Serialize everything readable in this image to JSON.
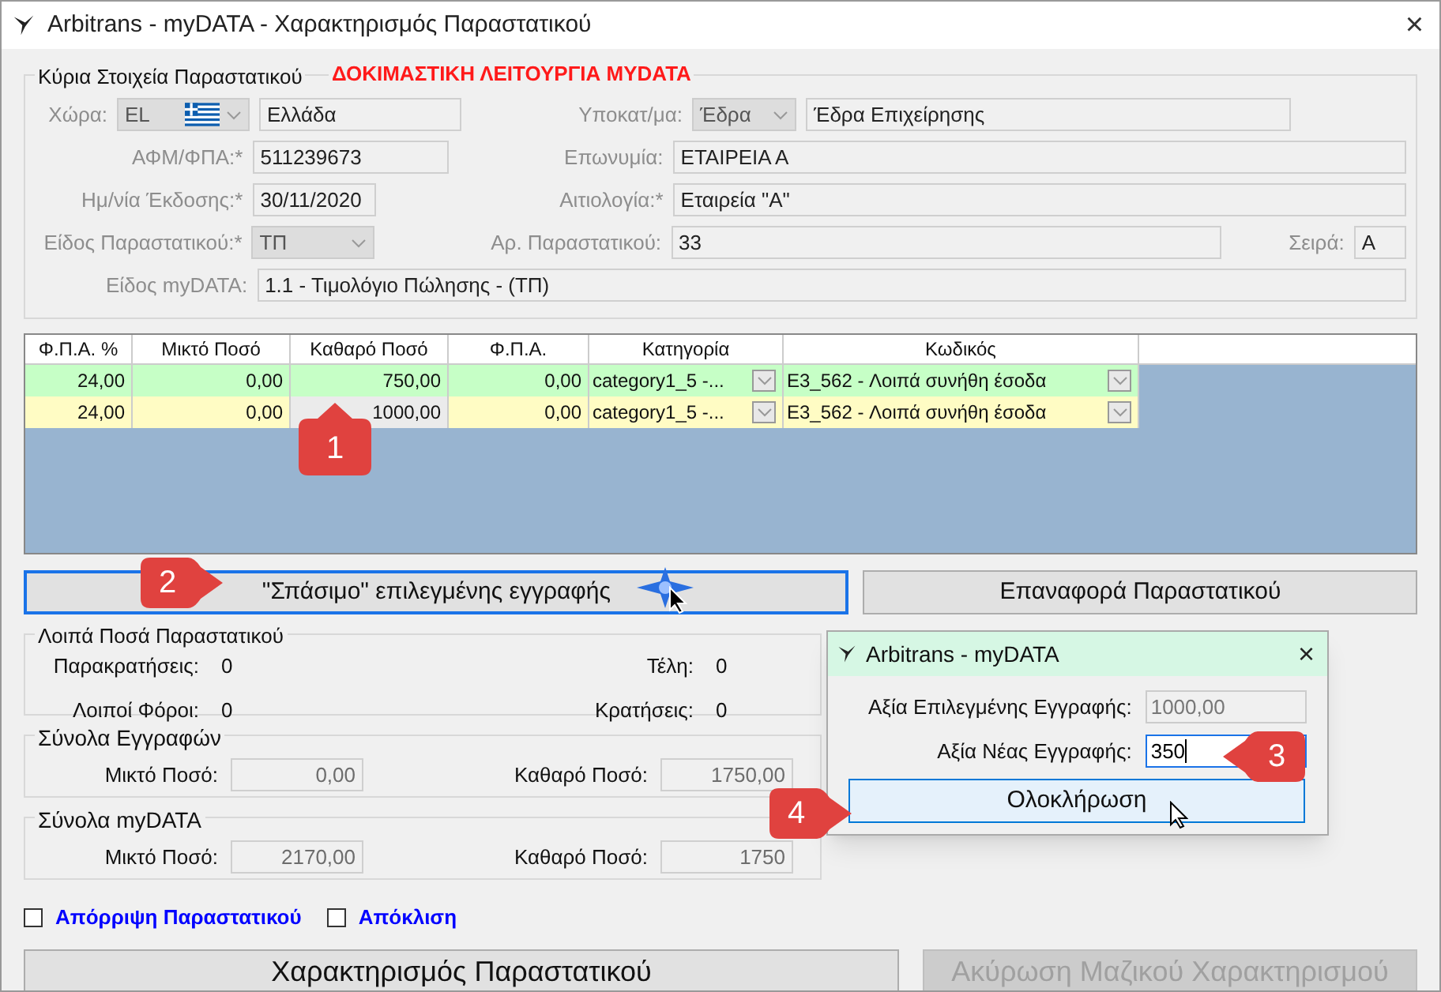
{
  "window": {
    "title": "Arbitrans - myDATA - Χαρακτηρισμός Παραστατικού",
    "close": "×"
  },
  "main_group": {
    "legend": "Κύρια Στοιχεία Παραστατικού",
    "warning": "ΔΟΚΙΜΑΣΤΙΚΗ ΛΕΙΤΟΥΡΓΙΑ MYDATA",
    "country": {
      "label": "Χώρα:",
      "code": "EL",
      "name": "Ελλάδα"
    },
    "subcategory": {
      "label": "Υποκατ/μα:",
      "value": "Έδρα",
      "name": "Έδρα Επιχείρησης"
    },
    "vat_number": {
      "label": "ΑΦΜ/ΦΠΑ:*",
      "value": "511239673"
    },
    "company": {
      "label": "Επωνυμία:",
      "value": "ΕΤΑΙΡΕΙΑ Α"
    },
    "issue_date": {
      "label": "Ημ/νία Έκδοσης:*",
      "value": "30/11/2020"
    },
    "reason": {
      "label": "Αιτιολογία:*",
      "value": "Εταιρεία \"Α\""
    },
    "doc_type": {
      "label": "Είδος Παραστατικού:*",
      "value": "ΤΠ"
    },
    "doc_number": {
      "label": "Αρ. Παραστατικού:",
      "value": "33"
    },
    "series": {
      "label": "Σειρά:",
      "value": "Α"
    },
    "mydata_type": {
      "label": "Είδος myDATA:",
      "value": "1.1 - Τιμολόγιο Πώλησης - (ΤΠ)"
    }
  },
  "table": {
    "columns": [
      "Φ.Π.Α. %",
      "Μικτό Ποσό",
      "Καθαρό Ποσό",
      "Φ.Π.Α.",
      "Κατηγορία",
      "Κωδικός"
    ],
    "rows": [
      {
        "selected": false,
        "cells": [
          "24,00",
          "0,00",
          "750,00",
          "0,00",
          "category1_5  -...",
          "E3_562 - Λοιπά συνήθη έσοδα"
        ]
      },
      {
        "selected": true,
        "cells": [
          "24,00",
          "0,00",
          "1000,00",
          "0,00",
          "category1_5  -...",
          "E3_562 - Λοιπά συνήθη έσοδα"
        ]
      }
    ]
  },
  "split_button": "\"Σπάσιμο\" επιλεγμένης εγγραφής",
  "reset_button": "Επαναφορά Παραστατικού",
  "other_amounts": {
    "legend": "Λοιπά Ποσά Παραστατικού",
    "items": [
      {
        "label": "Παρακρατήσεις:",
        "value": "0"
      },
      {
        "label": "Τέλη:",
        "value": "0"
      },
      {
        "label": "Λοιποί Φόροι:",
        "value": "0"
      },
      {
        "label": "Κρατήσεις:",
        "value": "0"
      }
    ]
  },
  "entry_totals": {
    "legend": "Σύνολα Εγγραφών",
    "items": [
      {
        "label": "Μικτό Ποσό:",
        "value": "0,00"
      },
      {
        "label": "Καθαρό Ποσό:",
        "value": "1750,00"
      }
    ]
  },
  "mydata_totals": {
    "legend": "Σύνολα myDATA",
    "items": [
      {
        "label": "Μικτό Ποσό:",
        "value": "2170,00"
      },
      {
        "label": "Καθαρό Ποσό:",
        "value": "1750"
      }
    ]
  },
  "checkboxes": [
    {
      "label": "Απόρριψη Παραστατικού",
      "checked": false
    },
    {
      "label": "Απόκλιση",
      "checked": false
    }
  ],
  "characterize_button": {
    "label": "Χαρακτηρισμός Παραστατικού",
    "disabled": false
  },
  "cancel_button": {
    "label": "Ακύρωση Μαζικού Χαρακτηρισμού",
    "disabled": true
  },
  "dialog": {
    "title": "Arbitrans - myDATA",
    "close": "×",
    "fields": [
      {
        "label": "Αξία Επιλεγμένης Εγγραφής:",
        "value": "1000,00",
        "disabled": true
      },
      {
        "label": "Αξία Νέας Εγγραφής:",
        "value": "350",
        "disabled": false
      }
    ],
    "button": "Ολοκλήρωση"
  },
  "callouts": [
    {
      "number": "1",
      "kind": "up"
    },
    {
      "number": "2",
      "kind": "right"
    },
    {
      "number": "3",
      "kind": "left"
    },
    {
      "number": "4",
      "kind": "right"
    }
  ]
}
